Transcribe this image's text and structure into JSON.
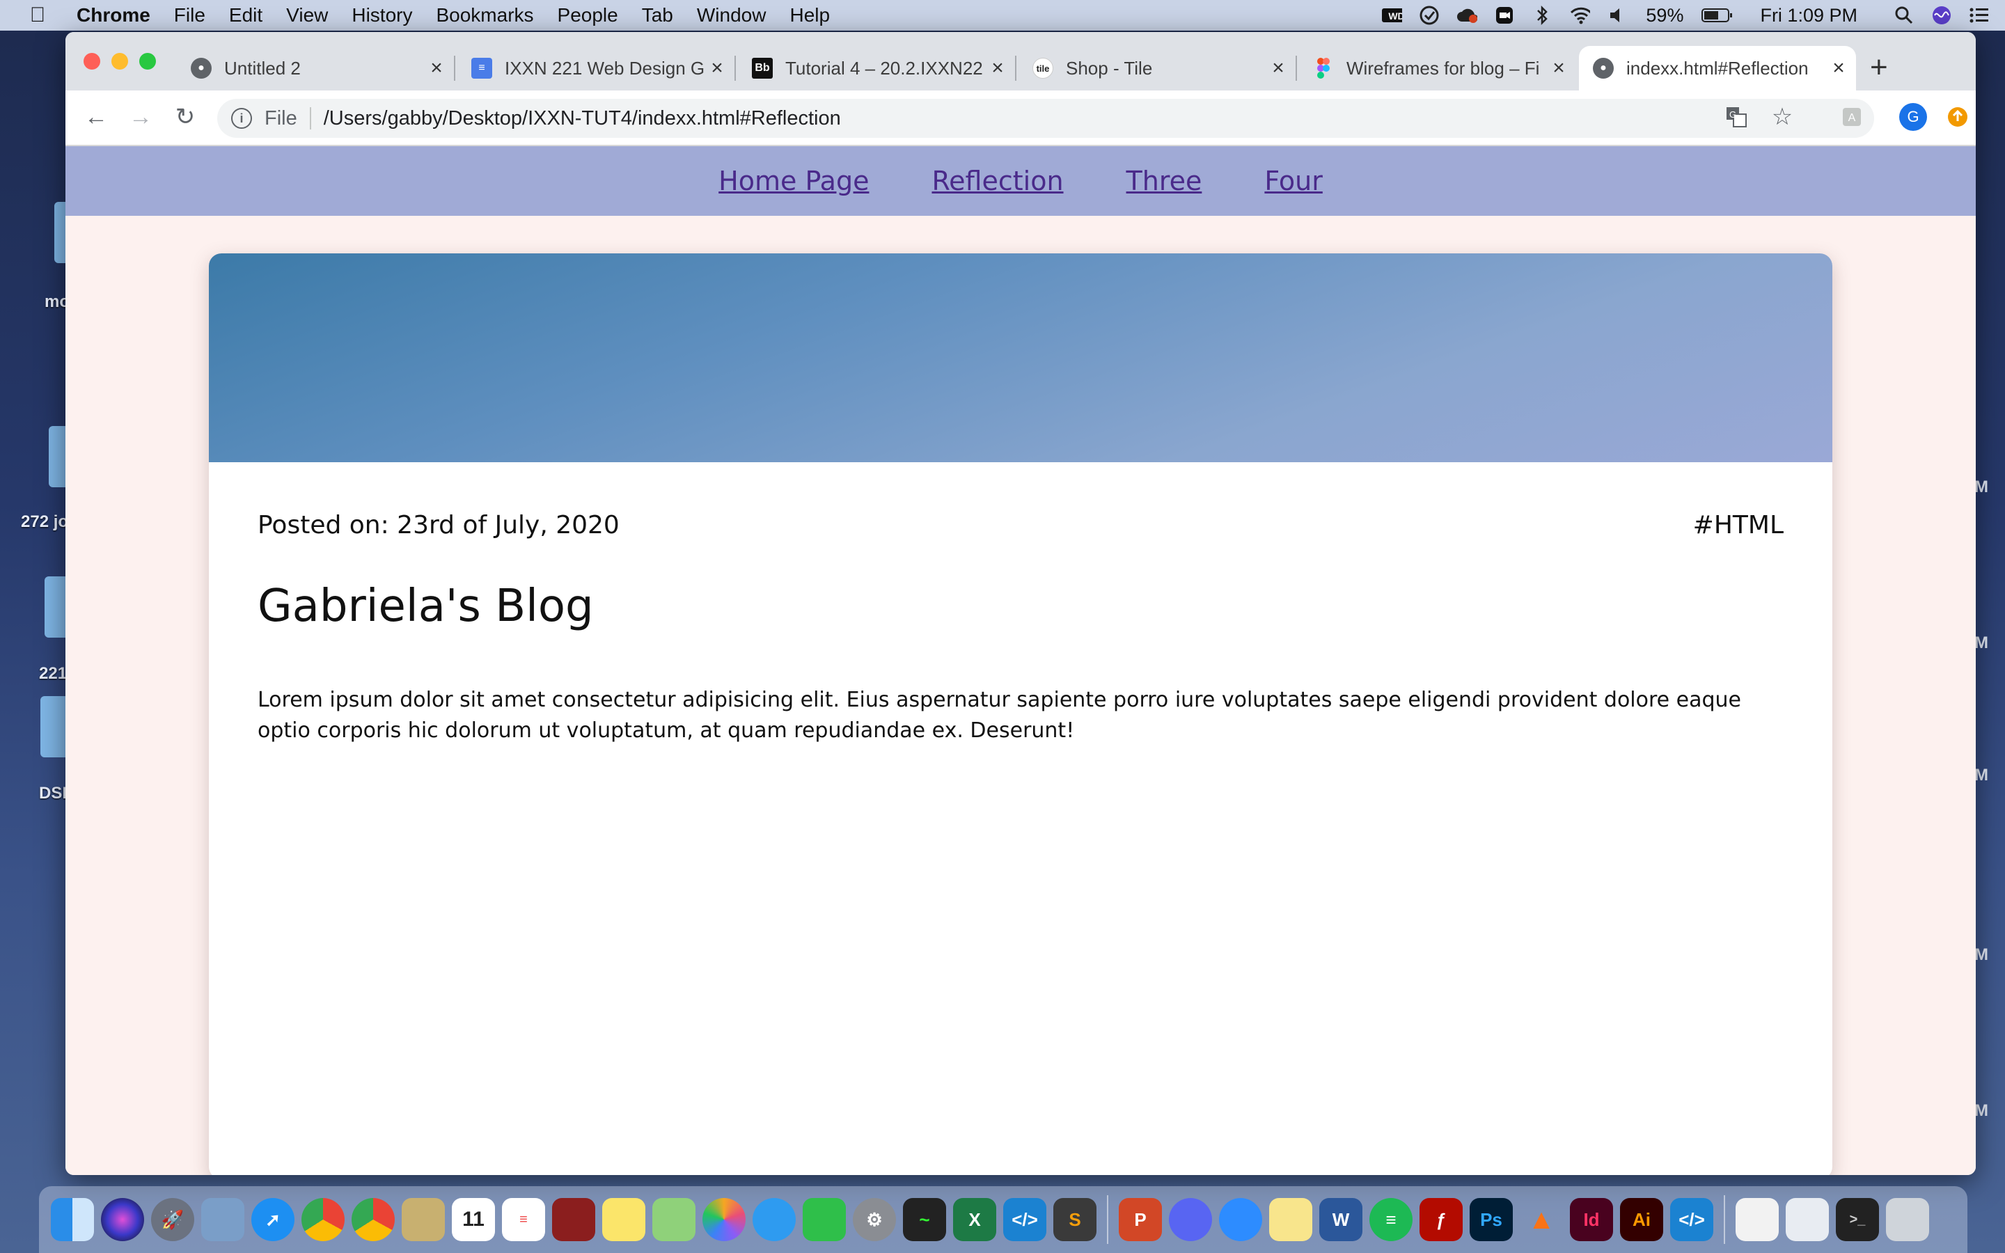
{
  "menubar": {
    "app_name": "Chrome",
    "items": [
      "File",
      "Edit",
      "View",
      "History",
      "Bookmarks",
      "People",
      "Tab",
      "Window",
      "Help"
    ],
    "battery": "59%",
    "clock": "Fri 1:09 PM"
  },
  "desktop": {
    "labels": [
      "mo",
      "272 jo",
      "221",
      "DSI"
    ],
    "right_labels": [
      "M",
      "M",
      "M",
      "M",
      "M"
    ]
  },
  "browser": {
    "tabs": [
      {
        "title": "Untitled 2",
        "favicon": "globe-icon"
      },
      {
        "title": "IXXN 221 Web Design G",
        "favicon": "google-docs-icon"
      },
      {
        "title": "Tutorial 4 – 20.2.IXXN22",
        "favicon": "blackboard-icon"
      },
      {
        "title": "Shop - Tile",
        "favicon": "tile-icon"
      },
      {
        "title": "Wireframes for blog – Fi",
        "favicon": "figma-icon"
      },
      {
        "title": "indexx.html#Reflection",
        "favicon": "globe-icon"
      }
    ],
    "active_tab": 5,
    "address": {
      "scheme_label": "File",
      "url": "/Users/gabby/Desktop/IXXN-TUT4/indexx.html#Reflection"
    },
    "profile_initial": "G"
  },
  "page": {
    "nav": [
      "Home Page",
      "Reflection",
      "Three",
      "Four"
    ],
    "post": {
      "posted_on": "Posted on: 23rd of July, 2020",
      "tag": "#HTML",
      "title": "Gabriela's Blog",
      "body": "Lorem ipsum dolor sit amet consectetur adipisicing elit. Eius aspernatur sapiente porro iure voluptates saepe eligendi provident dolore eaque optio corporis hic dolorum ut voluptatum, at quam repudiandae ex. Deserunt!"
    }
  },
  "colors": {
    "nav_bg": "#a0aad6",
    "nav_link": "#4a2a8a",
    "page_bg": "#fdf1ef",
    "hero_start": "#3c7aa8",
    "hero_end": "#9aa8d6"
  },
  "dock": {
    "icons": [
      "finder-icon",
      "siri-icon",
      "launchpad-icon",
      "preview-icon",
      "safari-icon",
      "chrome-icon",
      "chrome-icon",
      "mail-icon",
      "calendar-icon",
      "reminders-icon",
      "photo-booth-icon",
      "notes-icon",
      "maps-icon",
      "photos-icon",
      "messages-icon",
      "facetime-icon",
      "system-preferences-icon",
      "activity-monitor-icon",
      "excel-icon",
      "vscode-icon",
      "sublime-icon",
      "powerpoint-icon",
      "discord-icon",
      "zoom-icon",
      "stickies-icon",
      "word-icon",
      "spotify-icon",
      "acrobat-icon",
      "photoshop-icon",
      "hotspot-icon",
      "indesign-icon",
      "illustrator-icon",
      "vscode-icon",
      "finder-window-icon",
      "finder-window-icon",
      "terminal-icon",
      "trash-icon"
    ],
    "calendar_day": "11",
    "ps_label": "Ps",
    "id_label": "Id",
    "ai_label": "Ai"
  }
}
